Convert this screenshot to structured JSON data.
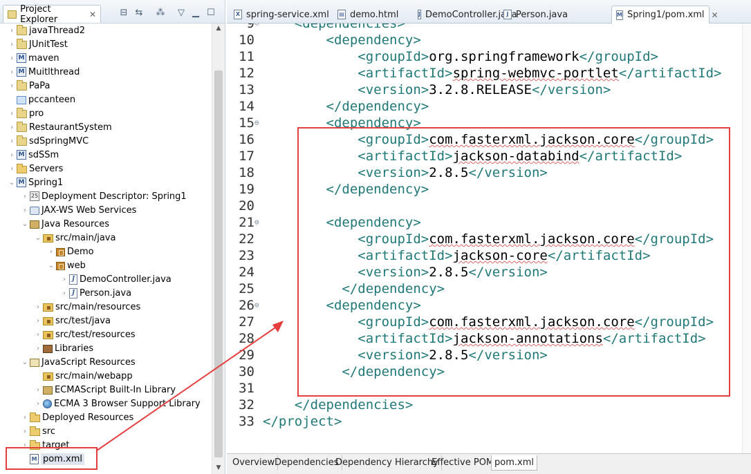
{
  "explorer": {
    "title": "Project Explorer",
    "items": [
      {
        "label": "javaThread2",
        "icon": "project-icon",
        "tw": "›"
      },
      {
        "label": "JUnitTest",
        "icon": "project-icon",
        "tw": "›"
      },
      {
        "label": "maven",
        "icon": "maven-project-icon",
        "tw": "›"
      },
      {
        "label": "Muitlthread",
        "icon": "maven-project-icon",
        "tw": "›"
      },
      {
        "label": "PaPa",
        "icon": "project-icon",
        "tw": "›"
      },
      {
        "label": "pccanteen",
        "icon": "closed-project-icon",
        "tw": ""
      },
      {
        "label": "pro",
        "icon": "project-icon",
        "tw": "›"
      },
      {
        "label": "RestaurantSystem",
        "icon": "project-icon",
        "tw": "›"
      },
      {
        "label": "sdSpringMVC",
        "icon": "project-icon",
        "tw": "›"
      },
      {
        "label": "sdSSm",
        "icon": "maven-project-icon",
        "tw": "›"
      },
      {
        "label": "Servers",
        "icon": "folder-icon",
        "tw": "›"
      },
      {
        "label": "Spring1",
        "icon": "maven-project-icon",
        "tw": "⌄"
      },
      {
        "label": "Deployment Descriptor: Spring1",
        "icon": "deployment-descriptor-icon",
        "tw": "›"
      },
      {
        "label": "JAX-WS Web Services",
        "icon": "web-services-icon",
        "tw": "›"
      },
      {
        "label": "Java Resources",
        "icon": "java-resources-icon",
        "tw": "⌄"
      },
      {
        "label": "src/main/java",
        "icon": "source-folder-icon",
        "tw": "⌄"
      },
      {
        "label": "Demo",
        "icon": "package-icon",
        "tw": "›"
      },
      {
        "label": "web",
        "icon": "package-icon",
        "tw": "⌄"
      },
      {
        "label": "DemoController.java",
        "icon": "java-file-icon",
        "tw": "›"
      },
      {
        "label": "Person.java",
        "icon": "java-file-icon",
        "tw": "›"
      },
      {
        "label": "src/main/resources",
        "icon": "source-folder-icon",
        "tw": "›"
      },
      {
        "label": "src/test/java",
        "icon": "source-folder-icon",
        "tw": "›"
      },
      {
        "label": "src/test/resources",
        "icon": "source-folder-icon",
        "tw": "›"
      },
      {
        "label": "Libraries",
        "icon": "library-icon",
        "tw": "›"
      },
      {
        "label": "JavaScript Resources",
        "icon": "javascript-resources-icon",
        "tw": "⌄"
      },
      {
        "label": "src/main/webapp",
        "icon": "source-folder-icon",
        "tw": ""
      },
      {
        "label": "ECMAScript Built-In Library",
        "icon": "jar-library-icon",
        "tw": "›"
      },
      {
        "label": "ECMA 3 Browser Support Library",
        "icon": "globe-icon",
        "tw": "›"
      },
      {
        "label": "Deployed Resources",
        "icon": "folder-icon",
        "tw": "›"
      },
      {
        "label": "src",
        "icon": "folder-icon",
        "tw": "›"
      },
      {
        "label": "target",
        "icon": "folder-icon",
        "tw": "›"
      },
      {
        "label": "pom.xml",
        "icon": "xml-file-icon",
        "tw": ""
      }
    ]
  },
  "editor": {
    "tabs": [
      {
        "label": "spring-service.xml",
        "icon": "X"
      },
      {
        "label": "demo.html",
        "icon": "▤"
      },
      {
        "label": "DemoController.java",
        "icon": "J"
      },
      {
        "label": "Person.java",
        "icon": "J"
      },
      {
        "label": "Spring1/pom.xml",
        "icon": "M"
      }
    ],
    "active_tab": "Spring1/pom.xml",
    "lines": [
      {
        "num": "9",
        "fold": "⊖",
        "indent": "    ",
        "parts": [
          [
            "tag",
            "<dependencies>"
          ]
        ]
      },
      {
        "num": "10",
        "fold": "",
        "indent": "        ",
        "parts": [
          [
            "tag",
            "<dependency>"
          ]
        ]
      },
      {
        "num": "11",
        "fold": "",
        "indent": "            ",
        "parts": [
          [
            "tag",
            "<groupId>"
          ],
          [
            "txt",
            "org.springframework"
          ],
          [
            "tag",
            "</groupId>"
          ]
        ]
      },
      {
        "num": "12",
        "fold": "",
        "indent": "            ",
        "parts": [
          [
            "tag",
            "<artifactId>"
          ],
          [
            "txt",
            "spring-webmvc-portlet"
          ],
          [
            "tag",
            "</artifactId>"
          ]
        ]
      },
      {
        "num": "13",
        "fold": "",
        "indent": "            ",
        "parts": [
          [
            "tag",
            "<version>"
          ],
          [
            "txt",
            "3.2.8.RELEASE"
          ],
          [
            "tag",
            "</version>"
          ]
        ]
      },
      {
        "num": "14",
        "fold": "",
        "indent": "        ",
        "parts": [
          [
            "tag",
            "</dependency>"
          ]
        ]
      },
      {
        "num": "15",
        "fold": "⊖",
        "indent": "        ",
        "parts": [
          [
            "tag",
            "<dependency>"
          ]
        ]
      },
      {
        "num": "16",
        "fold": "",
        "indent": "            ",
        "parts": [
          [
            "tag",
            "<groupId>"
          ],
          [
            "txt",
            "com.fasterxml.jackson.core"
          ],
          [
            "tag",
            "</groupId>"
          ]
        ]
      },
      {
        "num": "17",
        "fold": "",
        "indent": "            ",
        "parts": [
          [
            "tag",
            "<artifactId>"
          ],
          [
            "txt",
            "jackson-databind"
          ],
          [
            "tag",
            "</artifactId>"
          ]
        ]
      },
      {
        "num": "18",
        "fold": "",
        "indent": "            ",
        "parts": [
          [
            "tag",
            "<version>"
          ],
          [
            "txt",
            "2.8.5"
          ],
          [
            "tag",
            "</version>"
          ]
        ]
      },
      {
        "num": "19",
        "fold": "",
        "indent": "        ",
        "parts": [
          [
            "tag",
            "</dependency>"
          ]
        ]
      },
      {
        "num": "20",
        "fold": "",
        "indent": "",
        "parts": []
      },
      {
        "num": "21",
        "fold": "⊖",
        "indent": "        ",
        "parts": [
          [
            "tag",
            "<dependency>"
          ]
        ]
      },
      {
        "num": "22",
        "fold": "",
        "indent": "            ",
        "parts": [
          [
            "tag",
            "<groupId>"
          ],
          [
            "txt",
            "com.fasterxml.jackson.core"
          ],
          [
            "tag",
            "</groupId>"
          ]
        ]
      },
      {
        "num": "23",
        "fold": "",
        "indent": "            ",
        "parts": [
          [
            "tag",
            "<artifactId>"
          ],
          [
            "txt",
            "jackson-core"
          ],
          [
            "tag",
            "</artifactId>"
          ]
        ]
      },
      {
        "num": "24",
        "fold": "",
        "indent": "            ",
        "parts": [
          [
            "tag",
            "<version>"
          ],
          [
            "txt",
            "2.8.5"
          ],
          [
            "tag",
            "</version>"
          ]
        ]
      },
      {
        "num": "25",
        "fold": "",
        "indent": "          ",
        "parts": [
          [
            "tag",
            "</dependency>"
          ]
        ]
      },
      {
        "num": "26",
        "fold": "⊖",
        "indent": "        ",
        "parts": [
          [
            "tag",
            "<dependency>"
          ]
        ]
      },
      {
        "num": "27",
        "fold": "",
        "indent": "            ",
        "parts": [
          [
            "tag",
            "<groupId>"
          ],
          [
            "txt",
            "com.fasterxml.jackson.core"
          ],
          [
            "tag",
            "</groupId>"
          ]
        ]
      },
      {
        "num": "28",
        "fold": "",
        "indent": "            ",
        "parts": [
          [
            "tag",
            "<artifactId>"
          ],
          [
            "txt",
            "jackson-annotations"
          ],
          [
            "tag",
            "</artifactId>"
          ]
        ]
      },
      {
        "num": "29",
        "fold": "",
        "indent": "            ",
        "parts": [
          [
            "tag",
            "<version>"
          ],
          [
            "txt",
            "2.8.5"
          ],
          [
            "tag",
            "</version>"
          ]
        ]
      },
      {
        "num": "30",
        "fold": "",
        "indent": "          ",
        "parts": [
          [
            "tag",
            "</dependency>"
          ]
        ]
      },
      {
        "num": "31",
        "fold": "",
        "indent": "",
        "parts": []
      },
      {
        "num": "32",
        "fold": "",
        "indent": "    ",
        "parts": [
          [
            "tag",
            "</dependencies>"
          ]
        ]
      },
      {
        "num": "33",
        "fold": "",
        "indent": "",
        "parts": [
          [
            "tag",
            "</project>"
          ]
        ]
      }
    ],
    "bottom_tabs": [
      "Overview",
      "Dependencies",
      "Dependency Hierarchy",
      "Effective POM",
      "pom.xml"
    ],
    "active_bottom_tab": "pom.xml"
  },
  "annotation_color": "#e53e3e"
}
